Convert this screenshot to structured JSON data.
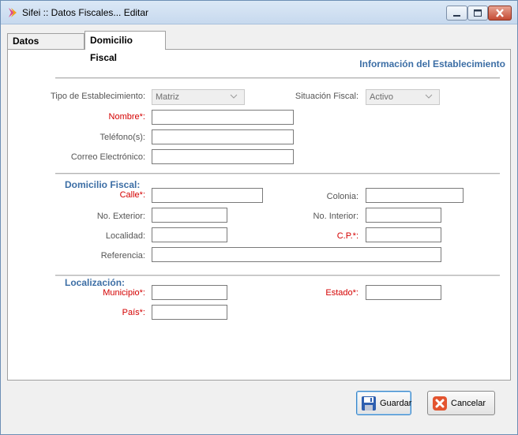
{
  "window": {
    "title": "Sifei :: Datos Fiscales... Editar"
  },
  "tabs": [
    {
      "label": "Datos Fiscales"
    },
    {
      "label": "Domicilio Fiscal"
    }
  ],
  "establecimiento": {
    "section_title": "Información del Establecimiento",
    "tipo_label": "Tipo de Establecimiento:",
    "tipo_value": "Matriz",
    "situacion_label": "Situación Fiscal:",
    "situacion_value": "Activo",
    "nombre_label": "Nombre*:",
    "telefono_label": "Teléfono(s):",
    "correo_label": "Correo Electrónico:"
  },
  "domicilio": {
    "section_title": "Domicilio Fiscal:",
    "calle_label": "Calle*:",
    "colonia_label": "Colonia:",
    "no_exterior_label": "No. Exterior:",
    "no_interior_label": "No. Interior:",
    "localidad_label": "Localidad:",
    "cp_label": "C.P.*:",
    "referencia_label": "Referencia:"
  },
  "localizacion": {
    "section_title": "Localización:",
    "municipio_label": "Municipio*:",
    "estado_label": "Estado*:",
    "pais_label": "País*:"
  },
  "buttons": {
    "guardar": "Guardar",
    "cancelar": "Cancelar"
  },
  "colors": {
    "section_title": "#3c6ea5",
    "required_label": "#d40000",
    "close_button": "#c44b34"
  }
}
